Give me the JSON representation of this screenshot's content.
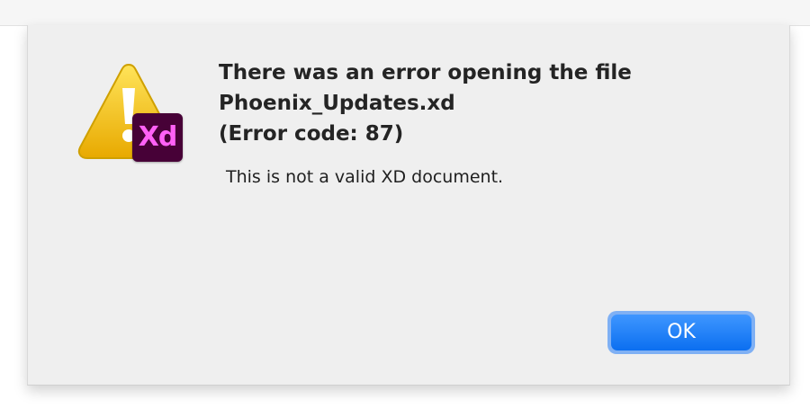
{
  "dialog": {
    "title_lines": [
      "There was an error opening the file",
      "Phoenix_Updates.xd",
      "(Error code: 87)"
    ],
    "message": "This is not a valid XD document.",
    "ok_label": "OK",
    "icon": {
      "warning": "warning-triangle-icon",
      "app_badge_text": "Xd",
      "app_badge_color": "#470137",
      "app_badge_text_color": "#ff61f6",
      "warning_color": "#f2c200"
    },
    "button_color": "#1a7cf5"
  }
}
